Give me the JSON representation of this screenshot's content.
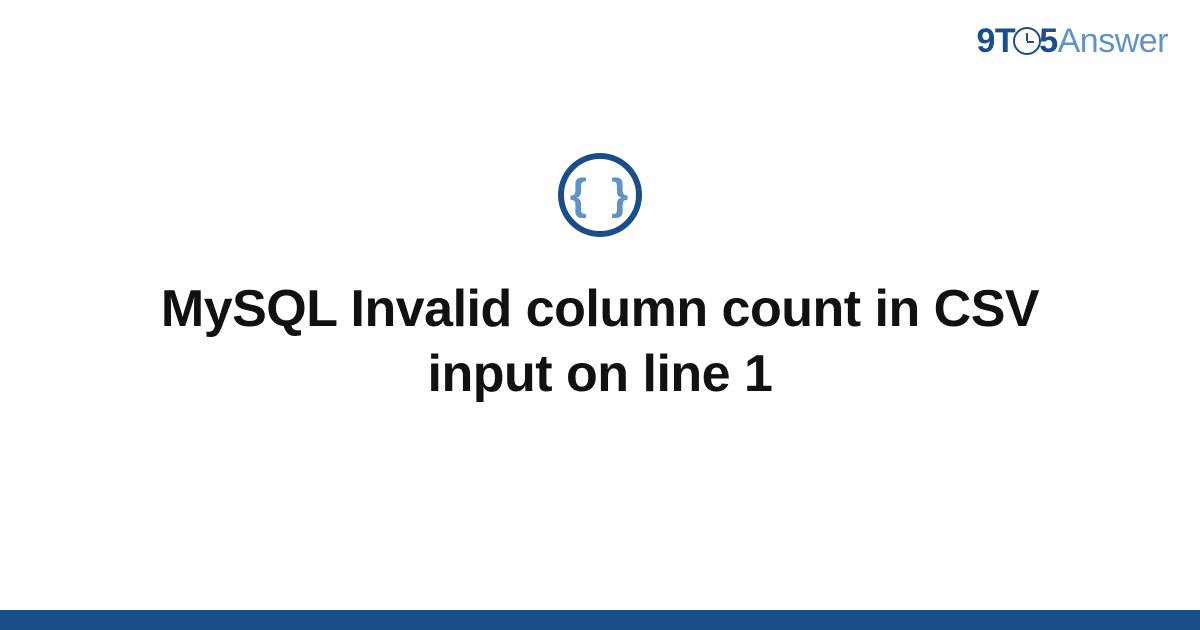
{
  "logo": {
    "part1": "9T",
    "part2": "5",
    "part3": "Answer"
  },
  "icon": {
    "braces": "{ }"
  },
  "title": "MySQL Invalid column count in CSV input on line 1"
}
